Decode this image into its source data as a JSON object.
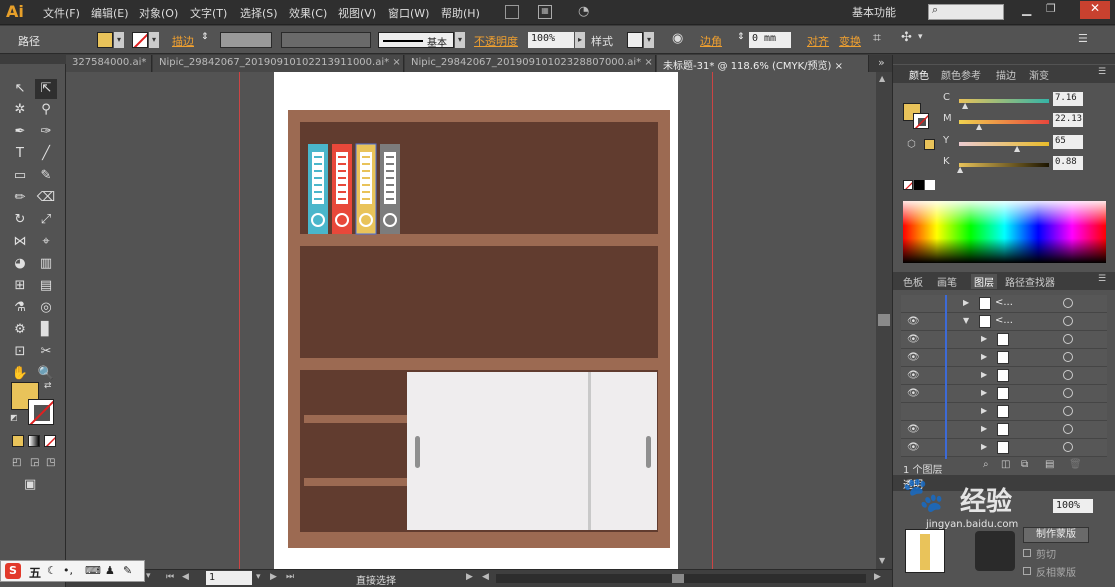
{
  "app": {
    "logo": "Ai",
    "workspace": "基本功能"
  },
  "menu": [
    "文件(F)",
    "编辑(E)",
    "对象(O)",
    "文字(T)",
    "选择(S)",
    "效果(C)",
    "视图(V)",
    "窗口(W)",
    "帮助(H)"
  ],
  "control": {
    "object_type": "路径",
    "stroke_label": "描边",
    "brush_label": "基本",
    "opacity_label": "不透明度",
    "opacity_value": "100%",
    "style_label": "样式",
    "corner_label": "边角",
    "corner_value": "0 mm",
    "align_label": "对齐",
    "transform_label": "变换",
    "fill_color": "#e9c35a"
  },
  "tabs": [
    {
      "label": "327584000.ai*",
      "active": false
    },
    {
      "label": "Nipic_29842067_20190910102213911000.ai*",
      "active": false
    },
    {
      "label": "Nipic_29842067_20190910102328807000.ai*",
      "active": false
    },
    {
      "label": "未标题-31* @ 118.6% (CMYK/预览)",
      "active": true
    }
  ],
  "status": {
    "zoom": "118.6%",
    "page": "1",
    "tool": "直接选择"
  },
  "color_panel": {
    "tabs": [
      "颜色",
      "颜色参考",
      "描边",
      "渐变"
    ],
    "channels": [
      {
        "name": "C",
        "value": "7.16",
        "pos": 0.07
      },
      {
        "name": "M",
        "value": "22.13",
        "pos": 0.22
      },
      {
        "name": "Y",
        "value": "65",
        "pos": 0.65
      },
      {
        "name": "K",
        "value": "0.88",
        "pos": 0.01
      }
    ]
  },
  "layers_panel": {
    "tabs": [
      "色板",
      "画笔",
      "图层",
      "路径查找器"
    ],
    "rows": [
      {
        "name": "<...",
        "indent": 0,
        "visible": false
      },
      {
        "name": "<...",
        "indent": 0,
        "visible": true,
        "expanded": true
      },
      {
        "name": "",
        "indent": 1,
        "visible": true
      },
      {
        "name": "",
        "indent": 1,
        "visible": true
      },
      {
        "name": "",
        "indent": 1,
        "visible": true
      },
      {
        "name": "",
        "indent": 1,
        "visible": true
      },
      {
        "name": "",
        "indent": 1,
        "visible": false
      },
      {
        "name": "",
        "indent": 1,
        "visible": true
      },
      {
        "name": "",
        "indent": 1,
        "visible": true
      }
    ],
    "footer": "1 个图层"
  },
  "transparency_panel": {
    "opacity": "100%",
    "make_mask": "制作蒙版",
    "clip": "剪切",
    "invert": "反相蒙版"
  },
  "artwork": {
    "cabinet_frame": "#9c6a52",
    "cabinet_inner": "#613c2f",
    "door": "#efedee",
    "handle": "#8f8f8f",
    "binders": [
      {
        "color": "#4ab6cb"
      },
      {
        "color": "#e8483a"
      },
      {
        "color": "#e9c35a"
      },
      {
        "color": "#7c7c7c"
      }
    ]
  },
  "watermark": "经验",
  "watermark_url": "jingyan.baidu.com",
  "ime": {
    "label": "五"
  }
}
